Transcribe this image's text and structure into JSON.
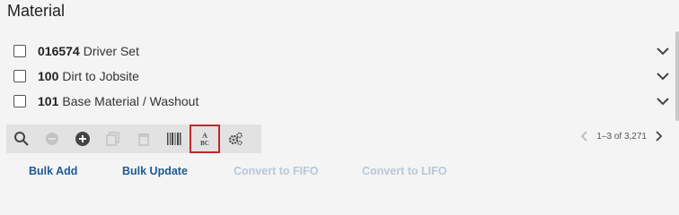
{
  "section": {
    "title": "Material"
  },
  "items": [
    {
      "code": "016574",
      "description": "Driver Set"
    },
    {
      "code": "100",
      "description": "Dirt to Jobsite"
    },
    {
      "code": "101",
      "description": "Base Material / Washout"
    }
  ],
  "toolbar": {
    "buttons": [
      {
        "icon": "search-icon",
        "enabled": true
      },
      {
        "icon": "block-icon",
        "enabled": false
      },
      {
        "icon": "add-circle-icon",
        "enabled": true
      },
      {
        "icon": "copy-icon",
        "enabled": false
      },
      {
        "icon": "trash-icon",
        "enabled": false
      },
      {
        "icon": "barcode-icon",
        "enabled": true
      },
      {
        "icon": "abc-sort-icon",
        "enabled": true,
        "selected": true
      },
      {
        "icon": "gears-icon",
        "enabled": true
      }
    ],
    "selected_color": "#c1272d"
  },
  "pagination": {
    "range_text": "1–3 of 3,271"
  },
  "actions": {
    "bulk_add": "Bulk Add",
    "bulk_update": "Bulk Update",
    "convert_fifo": "Convert to FIFO",
    "convert_lifo": "Convert to LIFO"
  },
  "colors": {
    "link": "#1f5a96",
    "link_disabled": "#b8c8d8",
    "toolbar_bg": "#e2e2e2"
  }
}
